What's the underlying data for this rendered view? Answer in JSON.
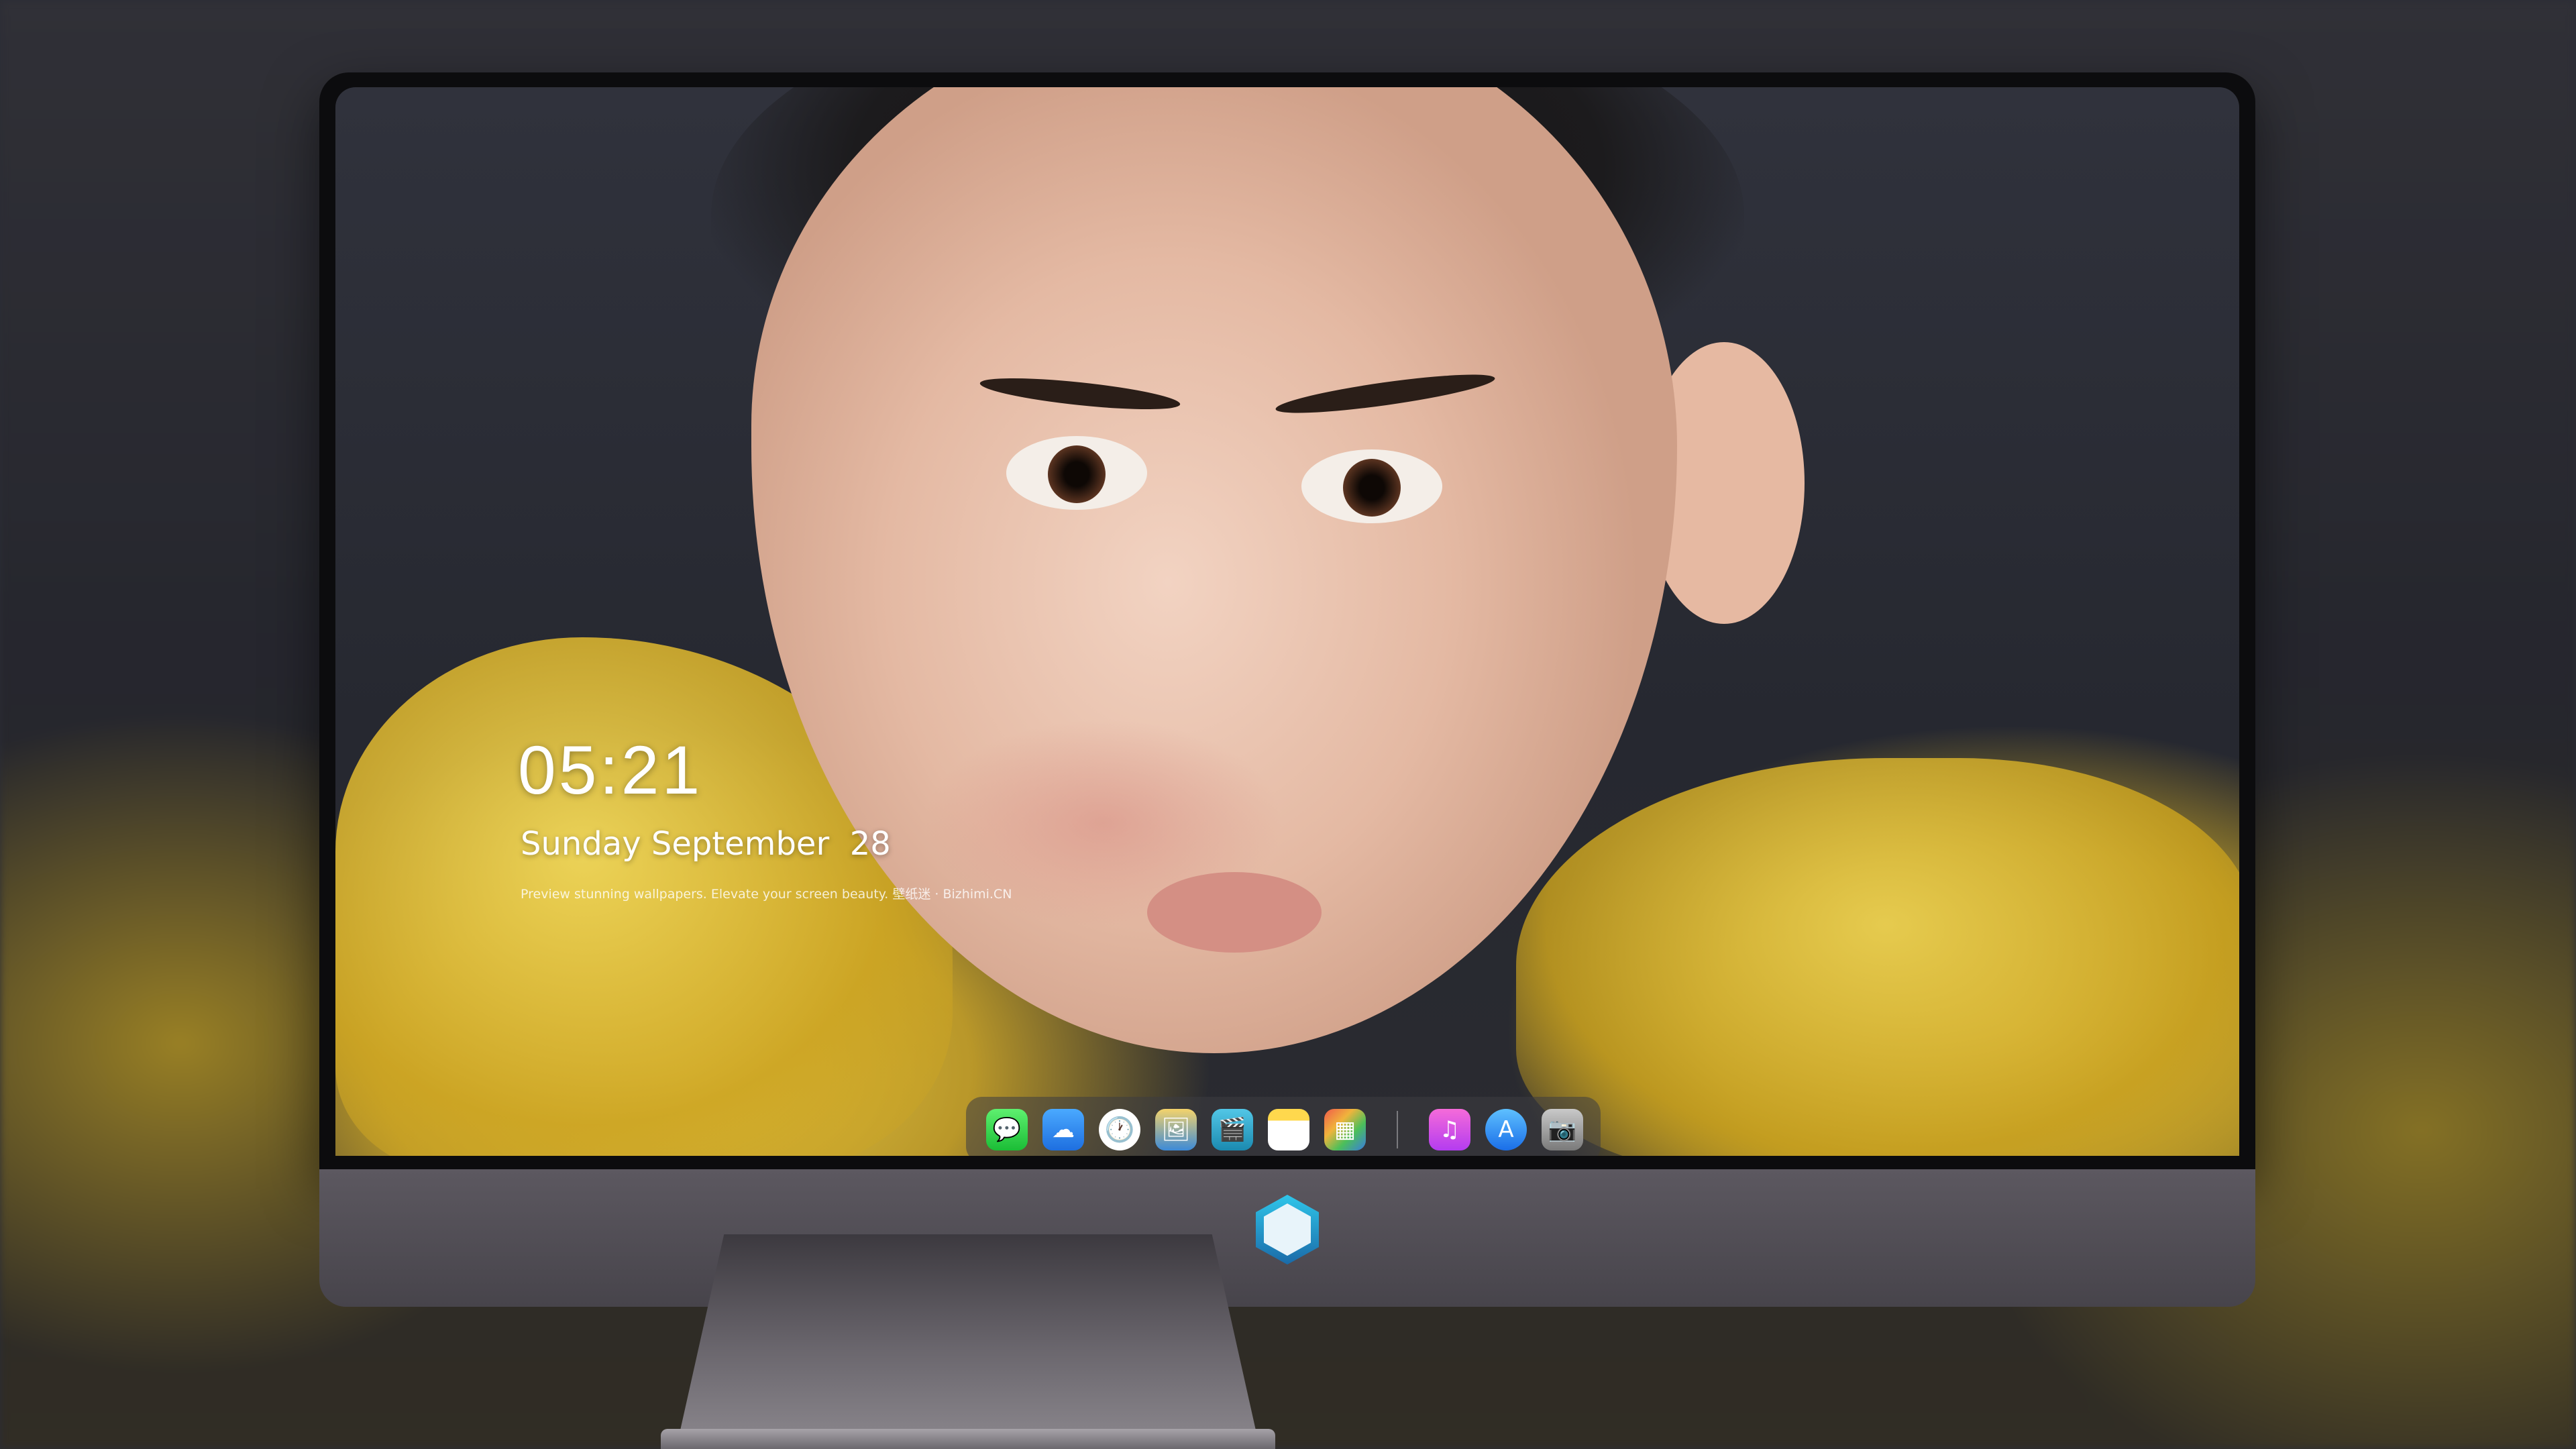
{
  "lock_screen": {
    "time": "05:21",
    "date": "Sunday September  28",
    "tagline": "Preview stunning wallpapers. Elevate your screen beauty. 壁纸迷 · Bizhimi.CN"
  },
  "dock": {
    "apps": [
      {
        "name": "messages-icon",
        "glyph": "💬"
      },
      {
        "name": "weather-icon",
        "glyph": "☁"
      },
      {
        "name": "clock-icon",
        "glyph": "🕐"
      },
      {
        "name": "preview-icon",
        "glyph": "🖼"
      },
      {
        "name": "claquette-icon",
        "glyph": "🎬"
      },
      {
        "name": "notes-icon",
        "glyph": ""
      },
      {
        "name": "photos-icon",
        "glyph": "▦"
      }
    ],
    "pinned": [
      {
        "name": "music-icon",
        "glyph": "♫"
      },
      {
        "name": "app-store-icon",
        "glyph": "A"
      },
      {
        "name": "camera-icon",
        "glyph": "📷"
      }
    ]
  },
  "colors": {
    "accent_yellow": "#d8b43a",
    "screen_bg": "#2a2c34",
    "monitor_chin": "#4f4b53"
  }
}
